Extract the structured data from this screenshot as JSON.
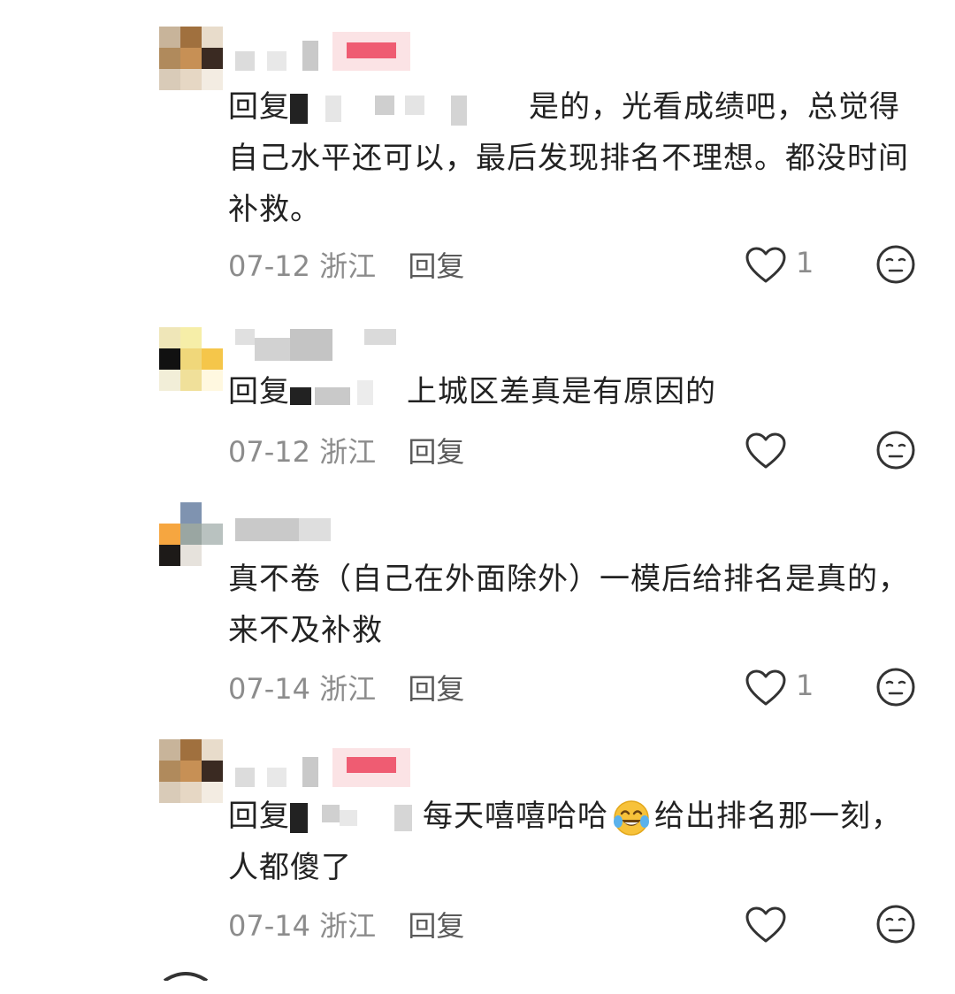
{
  "comments": [
    {
      "reply_prefix": "回复",
      "text": "是的，光看成绩吧，总觉得自己水平还可以，最后发现排名不理想。都没时间补救。",
      "date": "07-12",
      "location": "浙江",
      "reply_label": "回复",
      "likes": "1"
    },
    {
      "reply_prefix": "回复",
      "text": "上城区差真是有原因的",
      "date": "07-12",
      "location": "浙江",
      "reply_label": "回复",
      "likes": ""
    },
    {
      "reply_prefix": "",
      "text": "真不卷（自己在外面除外）一模后给排名是真的，来不及补救",
      "date": "07-14",
      "location": "浙江",
      "reply_label": "回复",
      "likes": "1"
    },
    {
      "reply_prefix": "回复",
      "text_before_emoji": "每天嘻嘻哈哈",
      "text_after_emoji": "给出排名那一刻，人都傻了",
      "date": "07-14",
      "location": "浙江",
      "reply_label": "回复",
      "likes": ""
    }
  ],
  "icons": {
    "like": "heart-outline-icon",
    "dislike": "meh-face-icon",
    "emoji": "tears-of-joy-emoji"
  },
  "colors": {
    "text": "#222222",
    "meta": "#8c8c8c",
    "reply_link": "#5a5a5a",
    "icon": "#333333"
  }
}
